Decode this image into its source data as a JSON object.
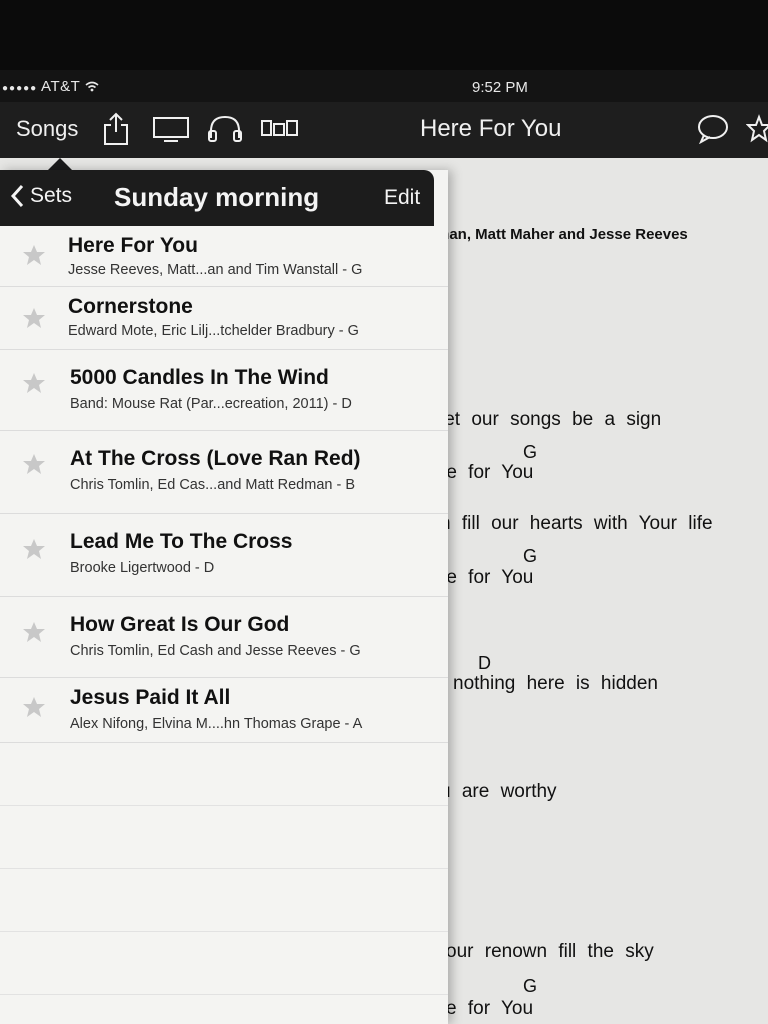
{
  "status": {
    "carrier": "AT&T",
    "time": "9:52 PM"
  },
  "nav": {
    "songs_label": "Songs",
    "title": "Here For You",
    "icons": [
      "share-icon",
      "display-icon",
      "headphones-icon",
      "layout-icon",
      "comment-icon",
      "star-icon"
    ]
  },
  "popover": {
    "back_label": "Sets",
    "title": "Sunday morning",
    "edit_label": "Edit",
    "songs": [
      {
        "title": "Here For You",
        "subtitle": "Jesse Reeves, Matt...an and Tim Wanstall - G"
      },
      {
        "title": "Cornerstone",
        "subtitle": "Edward Mote, Eric Lilj...tchelder Bradbury - G"
      },
      {
        "title": "5000 Candles In The Wind",
        "subtitle": "Band: Mouse Rat (Par...ecreation, 2011) - D"
      },
      {
        "title": "At The Cross (Love Ran Red)",
        "subtitle": "Chris Tomlin, Ed Cas...and Matt Redman - B"
      },
      {
        "title": "Lead Me To The Cross",
        "subtitle": "Brooke Ligertwood - D"
      },
      {
        "title": "How Great Is Our God",
        "subtitle": "Chris Tomlin, Ed Cash and Jesse Reeves - G"
      },
      {
        "title": "Jesus Paid It All",
        "subtitle": "Alex Nifong, Elvina M....hn Thomas Grape - A"
      }
    ]
  },
  "lyrics": {
    "credit": "man, Matt Maher and Jesse Reeves",
    "lines": [
      "let our songs be a sign",
      "re for You",
      "n fill our hearts with Your life",
      "re for You",
      "nothing here is hidden",
      "u are worthy",
      "our renown fill the sky",
      "e for You"
    ],
    "chords": [
      "G",
      "G",
      "D",
      "G"
    ]
  }
}
